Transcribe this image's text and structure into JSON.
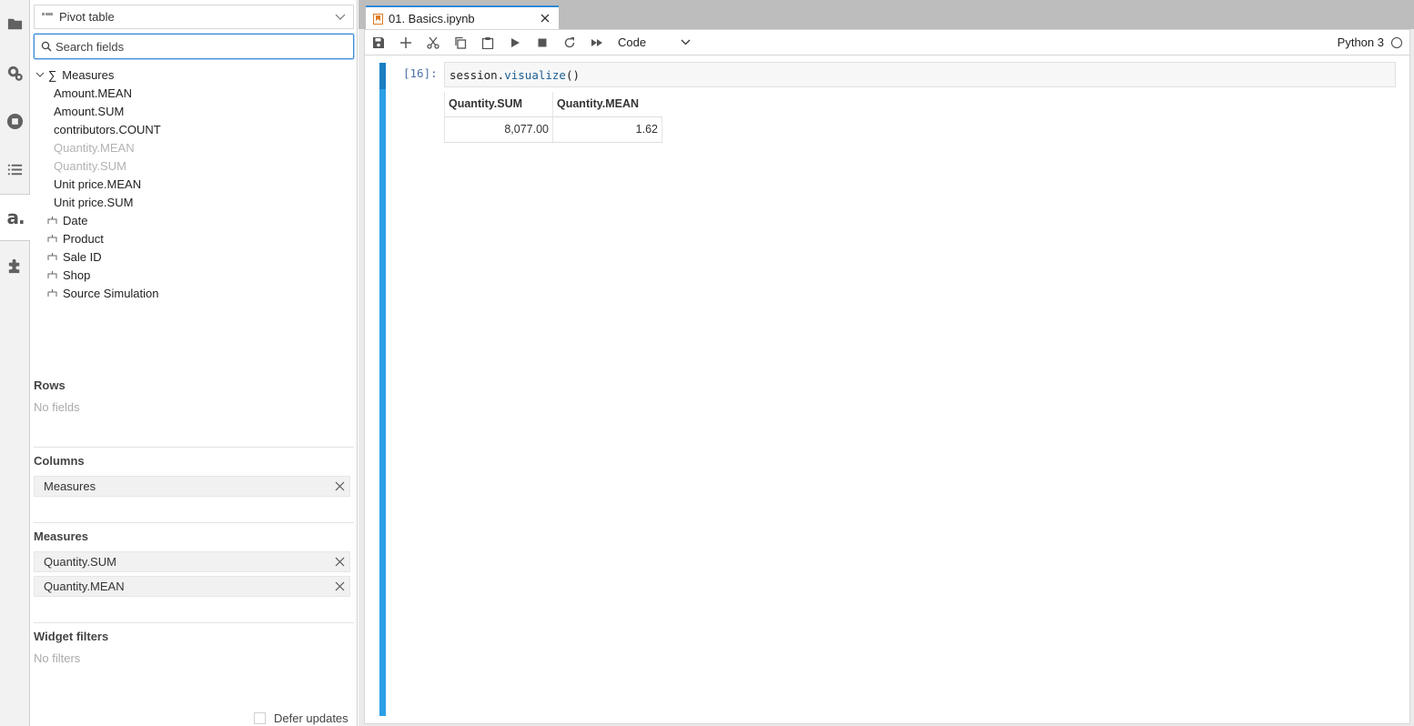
{
  "sidebar": {
    "icons": [
      "folder-icon",
      "running-icon",
      "stop-circle-icon",
      "toc-icon",
      "atoti-icon",
      "extension-icon"
    ],
    "brand_glyph": "a."
  },
  "panel": {
    "widget_type": "Pivot table",
    "search_placeholder": "Search fields",
    "tree": {
      "measures_group": "Measures",
      "measures": [
        {
          "label": "Amount.MEAN",
          "in_use": false
        },
        {
          "label": "Amount.SUM",
          "in_use": false
        },
        {
          "label": "contributors.COUNT",
          "in_use": false
        },
        {
          "label": "Quantity.MEAN",
          "in_use": true
        },
        {
          "label": "Quantity.SUM",
          "in_use": true
        },
        {
          "label": "Unit price.MEAN",
          "in_use": false
        },
        {
          "label": "Unit price.SUM",
          "in_use": false
        }
      ],
      "dimensions": [
        "Date",
        "Product",
        "Sale ID",
        "Shop",
        "Source Simulation"
      ]
    },
    "rows": {
      "title": "Rows",
      "empty": "No fields"
    },
    "columns": {
      "title": "Columns",
      "chips": [
        "Measures"
      ]
    },
    "measures": {
      "title": "Measures",
      "chips": [
        "Quantity.SUM",
        "Quantity.MEAN"
      ]
    },
    "filters": {
      "title": "Widget filters",
      "empty": "No filters"
    },
    "defer_label": "Defer updates"
  },
  "notebook": {
    "tab_title": "01. Basics.ipynb",
    "cell_type": "Code",
    "kernel": "Python 3",
    "cell": {
      "prompt": "[16]:",
      "code_obj": "session.",
      "code_method": "visualize",
      "code_args": "()"
    },
    "output": {
      "headers": [
        "Quantity.SUM",
        "Quantity.MEAN"
      ],
      "values": [
        "8,077.00",
        "1.62"
      ]
    }
  }
}
